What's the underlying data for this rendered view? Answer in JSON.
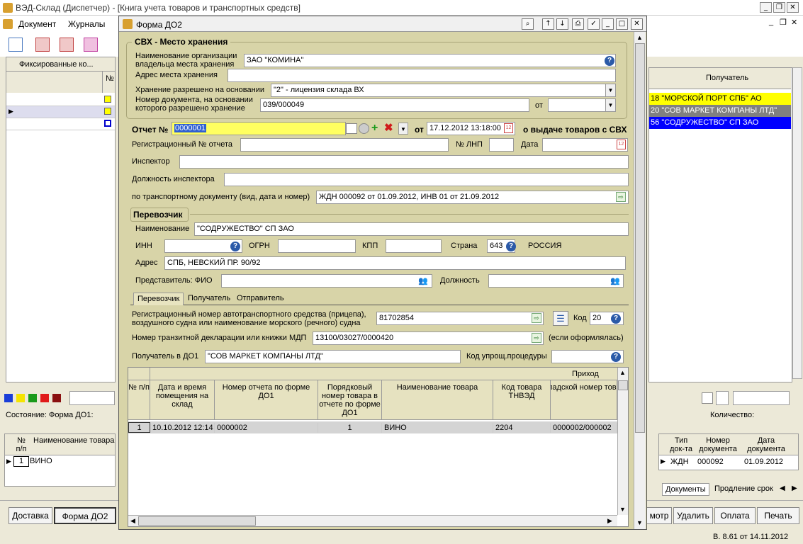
{
  "app": {
    "title": "ВЭД-Склад (Диспетчер) - [Книга учета товаров и транспортных средств]",
    "menu": [
      "Документ",
      "Журналы"
    ],
    "status_label": "Состояние:",
    "status_value": "Форма ДО1:",
    "quantity_label": "Количество:",
    "version": "В. 8.61 от 14.11.2012"
  },
  "left_grid": {
    "header": "Фиксированные ко...",
    "num_header": "№"
  },
  "right_grid": {
    "header": "Получатель",
    "rows": [
      {
        "prefix": "18",
        "text": "\"МОРСКОЙ ПОРТ СПБ\" АО",
        "bg": "#ffff00",
        "color": "#000000"
      },
      {
        "prefix": "20",
        "text": "\"СОВ МАРКЕТ КОМПАНЫ ЛТД\"",
        "bg": "#808080",
        "color": "#ffffff"
      },
      {
        "prefix": "56",
        "text": "\"СОДРУЖЕСТВО\" СП ЗАО",
        "bg": "#0000ff",
        "color": "#ffffff"
      }
    ]
  },
  "colors": [
    "#1a3ed8",
    "#f5e400",
    "#1a9a1a",
    "#e01a1a",
    "#8a1010"
  ],
  "lower_left": {
    "num_header": "№ п/п",
    "name_header": "Наименование товара",
    "row_num": "1",
    "row_name": "ВИНО"
  },
  "lower_right": {
    "headers": [
      "Тип док-та",
      "Номер документа",
      "Дата документа"
    ],
    "row": [
      "ЖДН",
      "000092",
      "01.09.2012"
    ],
    "tabs": [
      "Документы",
      "Продление срок"
    ]
  },
  "bottom_buttons_left": [
    "Доставка",
    "Форма ДО2"
  ],
  "bottom_buttons_right": [
    "мотр",
    "Удалить",
    "Оплата",
    "Печать"
  ],
  "dialog": {
    "title": "Форма ДО2",
    "svh": {
      "section_title": "СВХ - Место хранения",
      "org_label": "Наименование организации владельца места хранения",
      "org_value": "ЗАО \"КОМИНА\"",
      "address_label": "Адрес места хранения",
      "address_value": "",
      "basis_label": "Хранение разрешено на основании",
      "basis_value": "\"2\" - лицензия склада ВХ",
      "docnum_label": "Номер документа, на основании которого разрешено хранение",
      "docnum_value": "039/000049",
      "from_label": "от",
      "from_value": ""
    },
    "report": {
      "label": "Отчет №",
      "number": "0000001",
      "date_label": "от",
      "date_value": "17.12.2012 13:18:00",
      "suffix": "о выдаче товаров с СВХ",
      "reg_label": "Регистрационный № отчета",
      "reg_value": "",
      "lnp_label": "№ ЛНП",
      "lnp_value": "",
      "date2_label": "Дата",
      "date2_value": "",
      "inspector_label": "Инспектор",
      "inspector_value": "",
      "position_label": "Должность инспектора",
      "position_value": "",
      "transport_doc_label": "по транспортному документу (вид, дата и номер)",
      "transport_doc_value": "ЖДН 000092 от 01.09.2012,  ИНВ 01 от 21.09.2012"
    },
    "carrier": {
      "section_title": "Перевозчик",
      "name_label": "Наименование",
      "name_value": "\"СОДРУЖЕСТВО\" СП ЗАО",
      "inn_label": "ИНН",
      "inn_value": "",
      "ogrn_label": "ОГРН",
      "ogrn_value": "",
      "kpp_label": "КПП",
      "kpp_value": "",
      "country_label": "Страна",
      "country_code": "643",
      "country_name": "РОССИЯ",
      "address_label": "Адрес",
      "address_value": "СПБ, НЕВСКИЙ ПР. 90/92",
      "rep_label": "Представитель: ФИО",
      "rep_value": "",
      "rep_pos_label": "Должность",
      "rep_pos_value": ""
    },
    "tabs": [
      "Перевозчик",
      "Получатель",
      "Отправитель"
    ],
    "vehicle": {
      "reg_label_1": "Регистрационный номер автотранспортного средства (прицепа),",
      "reg_label_2": "воздушного судна или наименование морского (речного) судна",
      "reg_value": "81702854",
      "code_label": "Код",
      "code_value": "20",
      "transit_label": "Номер транзитной декларации или книжки МДП",
      "transit_value": "13100/03027/0000420",
      "transit_note": "(если оформлялась)",
      "recipient_label": "Получатель в ДО1",
      "recipient_value": "\"СОВ МАРКЕТ КОМПАНЫ ЛТД\"",
      "proc_label": "Код упрощ.процедуры",
      "proc_value": ""
    },
    "grid": {
      "group_header": "Приход",
      "headers": [
        "№ п/п",
        "Дата и время помещения на склад",
        "Номер отчета по форме ДО1",
        "Порядковый номер товара в отчете по форме ДО1",
        "Наименование товара",
        "Код товара ТНВЭД",
        "Складской номер товара"
      ],
      "rows": [
        [
          "1",
          "10.10.2012 12:14",
          "0000002",
          "1",
          "ВИНО",
          "2204",
          "0000002/000002"
        ]
      ]
    }
  }
}
